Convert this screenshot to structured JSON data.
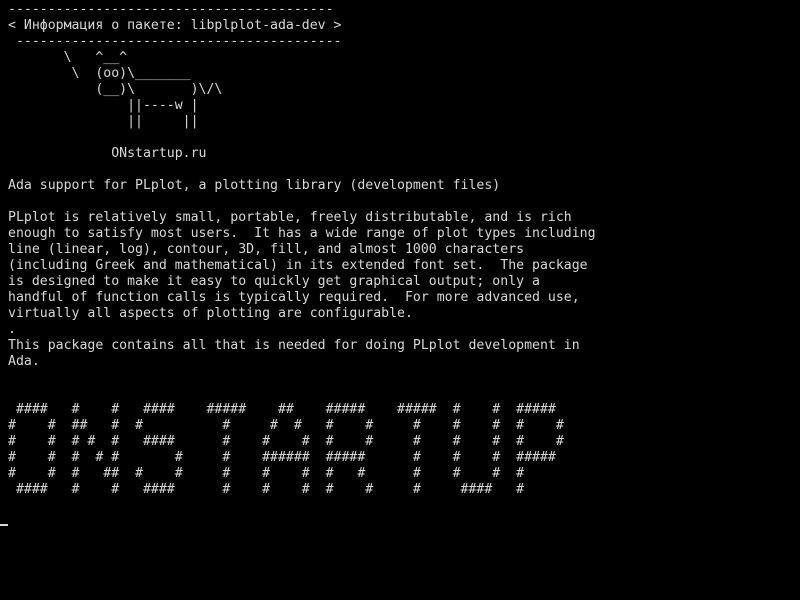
{
  "terminal": {
    "cowsay_output": "-----------------------------------------\n< Информация о пакете: libplplot-ada-dev >\n -----------------------------------------\n       \\   ^__^\n        \\  (oo)\\_______\n           (__)\\       )\\/\\\n               ||----w |\n               ||     ||\n\n             ONstartup.ru",
    "package_summary": "Ada support for PLplot, a plotting library (development files)",
    "package_description": "PLplot is relatively small, portable, freely distributable, and is rich\nenough to satisfy most users.  It has a wide range of plot types including\nline (linear, log), contour, 3D, fill, and almost 1000 characters\n(including Greek and mathematical) in its extended font set.  The package\nis designed to make it easy to quickly get graphical output; only a\nhandful of function calls is typically required.  For more advanced use,\nvirtually all aspects of plotting are configurable.\n.\nThis package contains all that is needed for doing PLplot development in\nAda.",
    "banner_art": " ####   #    #   ####    #####    ##    #####    #####  #    #  #####\n#    #  ##   #  #          #     #  #   #    #     #    #    #  #    #\n#    #  # #  #   ####      #    #    #  #    #     #    #    #  #    #\n#    #  #  # #       #     #    ######  #####      #    #    #  #####\n#    #  #   ##  #    #     #    #    #  #   #      #    #    #  #\n ####   #    #   ####      #    #    #  #    #     #     ####   #"
  },
  "colors": {
    "background": "#000000",
    "foreground": "#d8d8d8"
  }
}
